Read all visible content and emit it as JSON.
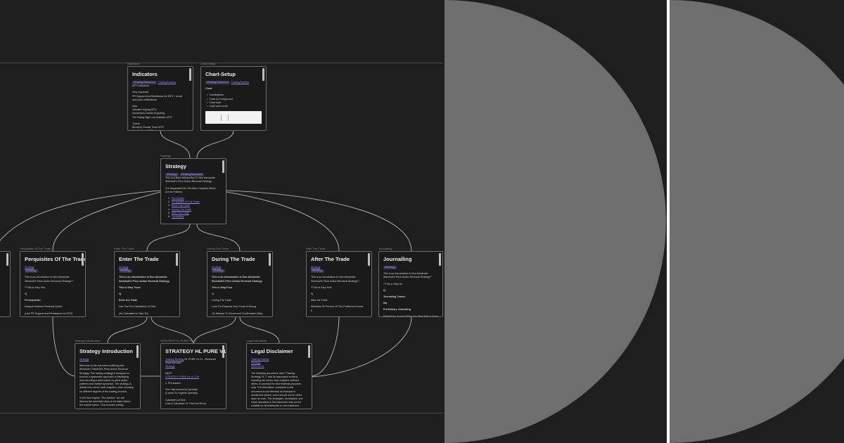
{
  "canvas": {
    "nodes": [
      {
        "id": "indicators",
        "label": "Indicators",
        "title": "Indicators",
        "lines": [
          {
            "tags": [
              "#Trading-Resources"
            ],
            "links": [
              "Trading/Trading"
            ]
          },
          {
            "text": "MTS Indicators"
          },
          {
            "gap": true
          },
          {
            "text": "Very Important"
          },
          {
            "text": "PR Support And Resistance for MTS + email"
          },
          {
            "text": "and push notifications"
          },
          {
            "gap": true
          },
          {
            "text": "Aids"
          },
          {
            "text": "Valuable ZigZag MTS"
          },
          {
            "text": "Investment Candle Engulfing"
          },
          {
            "text": "The Swing High Low Indicator MTS"
          },
          {
            "gap": true
          },
          {
            "text": "Timers"
          },
          {
            "text": "Bluetech Candle Timer MTS"
          },
          {
            "text": "Candle Timer MTS"
          }
        ]
      },
      {
        "id": "chart-setup",
        "label": "Chart-Setup",
        "title": "Chart-Setup",
        "thumb": true,
        "lines": [
          {
            "tags": [
              "#Trading-Resources"
            ],
            "links": [
              "Trading/Trading"
            ]
          },
          {
            "gap": true
          },
          {
            "text": "Chart",
            "bold": true
          },
          {
            "gap": true
          },
          {
            "text": "  •  Candlesticks"
          },
          {
            "text": "  •  Chart on Foreground"
          },
          {
            "text": "  •  Chart shift"
          },
          {
            "text": "  •  Chart auto scroll"
          }
        ]
      },
      {
        "id": "strategy",
        "label": "Strategy",
        "title": "Strategy",
        "lines": [
          {
            "tags": [
              "#Strategy",
              "#Trading-Resources"
            ]
          },
          {
            "text": "This Is A Brief Introduction To Neo Alexander"
          },
          {
            "text": "Steinhoff's Price Action Reversal Strategy."
          },
          {
            "gap": true
          },
          {
            "text": "It Is Separated Into Six Main Chapters Which"
          },
          {
            "text": "Are As Follows;"
          },
          {
            "gap": true
          },
          {
            "num": "1.",
            "link": "Pre-Market"
          },
          {
            "num": "2.",
            "link": "Perquisites Of The Trade"
          },
          {
            "num": "3.",
            "link": "Enter The Trade"
          },
          {
            "num": "4.",
            "link": "During The Trade"
          },
          {
            "num": "5.",
            "link": "After The Trade"
          },
          {
            "num": "6.",
            "link": "Journalling"
          }
        ]
      },
      {
        "id": "pre-market",
        "label": "",
        "title": "",
        "lines": []
      },
      {
        "id": "perquisites",
        "label": "Perquisites Of The Trade",
        "title": "Perquisites Of The Trade",
        "lines": [
          {
            "links": [
              "Strategy"
            ]
          },
          {
            "tags": [
              "#Strategy"
            ]
          },
          {
            "gap": true
          },
          {
            "text": "This is an Introduction to Neo Alexander"
          },
          {
            "text": "Steinhoff's Price Action Reversal Strategy**"
          },
          {
            "gap": true
          },
          {
            "text": "**This is Step Two"
          },
          {
            "gap": true
          },
          {
            "text": "1)",
            "bold": true
          },
          {
            "gap": true
          },
          {
            "text": "Prerequisites",
            "bold": true
          },
          {
            "gap": true
          },
          {
            "text": "Analyze Extreme Reversal Zones"
          },
          {
            "gap": true
          },
          {
            "text": "(Use PR Support And Resistance for MTS)"
          }
        ]
      },
      {
        "id": "enter",
        "label": "Enter The Trade",
        "title": "Enter The Trade",
        "lines": [
          {
            "links": [
              "Strategy"
            ]
          },
          {
            "tags": [
              "#Strategy"
            ]
          },
          {
            "gap": true
          },
          {
            "text": "This is an Introduction to Neo Alexander",
            "bold": true
          },
          {
            "text": "Steinhoff's Price Action Reversal Strategy.",
            "bold": true
          },
          {
            "gap": true
          },
          {
            "text": "This is Step Three",
            "bold": true
          },
          {
            "gap": true
          },
          {
            "text": "3)",
            "bold": true
          },
          {
            "gap": true
          },
          {
            "text": "Enter the Trade",
            "bold": true
          },
          {
            "gap": true
          },
          {
            "text": "Use The Pre-Calculated Lot Size"
          },
          {
            "gap": true
          },
          {
            "text": "(As Calculated in Step 1b)"
          }
        ]
      },
      {
        "id": "during",
        "label": "During The Trade",
        "title": "During The Trade",
        "lines": [
          {
            "links": [
              "Strategy"
            ]
          },
          {
            "tags": [
              "#Strategy"
            ]
          },
          {
            "gap": true
          },
          {
            "text": "This is an Introduction to Neo Alexander",
            "bold": true
          },
          {
            "text": "Steinhoff's Price Action Reversal Strategy.",
            "bold": true
          },
          {
            "gap": true
          },
          {
            "text": "This is Step Four",
            "bold": true
          },
          {
            "gap": true
          },
          {
            "text": "4)"
          },
          {
            "gap": true
          },
          {
            "text": "During The Trade"
          },
          {
            "gap": true
          },
          {
            "text": "Look For Reasons Your Trade Is Wrong"
          },
          {
            "gap": true
          },
          {
            "text": "(To Attempt To Circumvent Confirmation Bias)"
          }
        ]
      },
      {
        "id": "after",
        "label": "After The Trade",
        "title": "After The Trade",
        "lines": [
          {
            "links": [
              "Strategy"
            ]
          },
          {
            "tags": [
              "#Strategy"
            ]
          },
          {
            "gap": true
          },
          {
            "text": "This is an Introduction to Neo Alexander"
          },
          {
            "text": "Steinhoff's Price Action Reversal Strategy**"
          },
          {
            "gap": true
          },
          {
            "text": "**This is Step Five"
          },
          {
            "gap": true
          },
          {
            "text": "5)"
          },
          {
            "gap": true
          },
          {
            "text": "After the Trade"
          },
          {
            "gap": true
          },
          {
            "text": "Withdraw 50 Percent Of The Profits And Invest"
          },
          {
            "text": "It"
          }
        ]
      },
      {
        "id": "journalling",
        "label": "Journalling",
        "title": "Journalling",
        "lines": [
          {
            "tags": [
              "#Strategy"
            ]
          },
          {
            "gap": true
          },
          {
            "text": "This is an Introduction to Neo Alexander"
          },
          {
            "text": "Steinhoff's Price Action Reversal Strategy**"
          },
          {
            "gap": true
          },
          {
            "text": "**This is Step six"
          },
          {
            "gap": true
          },
          {
            "text": "6)",
            "bold": true
          },
          {
            "gap": true
          },
          {
            "text": "Journaling Trades",
            "bold": true
          },
          {
            "gap": true
          },
          {
            "text": "6a)",
            "bold": true
          },
          {
            "gap": true
          },
          {
            "text": "Preliminary Journaling",
            "bold": true
          },
          {
            "gap": true
          },
          {
            "text": "Preliminary Journal When You First Take A Trade"
          }
        ]
      },
      {
        "id": "strategy-intro",
        "label": "Strategy Introduction",
        "title": "Strategy Introduction",
        "lines": [
          {
            "links": [
              "Strategy"
            ]
          },
          {
            "gap": true
          },
          {
            "text": "Welcome to the document outlining Neo"
          },
          {
            "text": "Alexander Steinhoff's Price Action Reversal"
          },
          {
            "text": "Strategy. This trading strategy is designed to"
          },
          {
            "text": "provide a systematic approach to identifying"
          },
          {
            "text": "and executing trades based on price action"
          },
          {
            "text": "patterns and market dynamics. The strategy is"
          },
          {
            "text": "divided into seven main chapters, each focusing"
          },
          {
            "text": "on different aspects of the trading process."
          },
          {
            "gap": true
          },
          {
            "text": "In the first chapter, \"Pre-Market,\" we will"
          },
          {
            "text": "discuss the essential steps to be taken before"
          },
          {
            "text": "the market opens. This includes sorting"
          }
        ]
      },
      {
        "id": "strategy-hl",
        "label": "STRATEGY HL PURE V1.21",
        "title": "STRATEGY HL PURE V1.21",
        "lines": [
          {
            "links": [
              "Trading Strategy"
            ],
            "text": " HL PURE V1.21 - Removed"
          },
          {
            "text": "Dependencies"
          },
          {
            "links": [
              "Strategy"
            ]
          },
          {
            "gap": true
          },
          {
            "text": "NEXT"
          },
          {
            "links": [
              "STRATEGY PURE HL V1.215"
            ]
          },
          {
            "gap": true
          },
          {
            "text": "1. Pre-Market"
          },
          {
            "gap": true
          },
          {
            "text": "Sort Instruments by Spreads"
          },
          {
            "text": "(Lowest To Highest Spreads)"
          },
          {
            "gap": true
          },
          {
            "text": "Calculate Lot Size"
          },
          {
            "text": "(Use A Calculator Or Trial And Error)"
          }
        ]
      },
      {
        "id": "legal",
        "label": "Legal Disclaimer",
        "title": "Legal Disclaimer",
        "lines": [
          {
            "links": [
              "Trading/Trading"
            ]
          },
          {
            "links": [
              "Strategy"
            ]
          },
          {
            "links": [
              "2023-01-01"
            ]
          },
          {
            "gap": true
          },
          {
            "text": "The following document, titled \"Trading"
          },
          {
            "text": "Strategy V1.7\" and its associated content,"
          },
          {
            "text": "including the seven main chapters outlined"
          },
          {
            "text": "within, is provided for informational purposes"
          },
          {
            "text": "only. The information contained in this"
          },
          {
            "text": "document is not intended as financial or"
          },
          {
            "text": "investment advice, and it should not be relied"
          },
          {
            "text": "upon as such. The strategies, techniques, and"
          },
          {
            "text": "steps described in this document may not be"
          },
          {
            "text": "suitable for all individuals or circumstances."
          }
        ]
      }
    ]
  },
  "colors": {
    "background": "#1e1e1e",
    "node_bg": "#1a1a1a",
    "node_border": "#6b6b6b",
    "link": "#9b86ec",
    "tag_bg": "#3a3452",
    "edge": "#cfcfcf",
    "circle": "#6e6e6e",
    "separator": "#ffffff"
  },
  "overlay_panels": [
    {
      "shape": "half-circle"
    },
    {
      "shape": "half-circle"
    }
  ]
}
